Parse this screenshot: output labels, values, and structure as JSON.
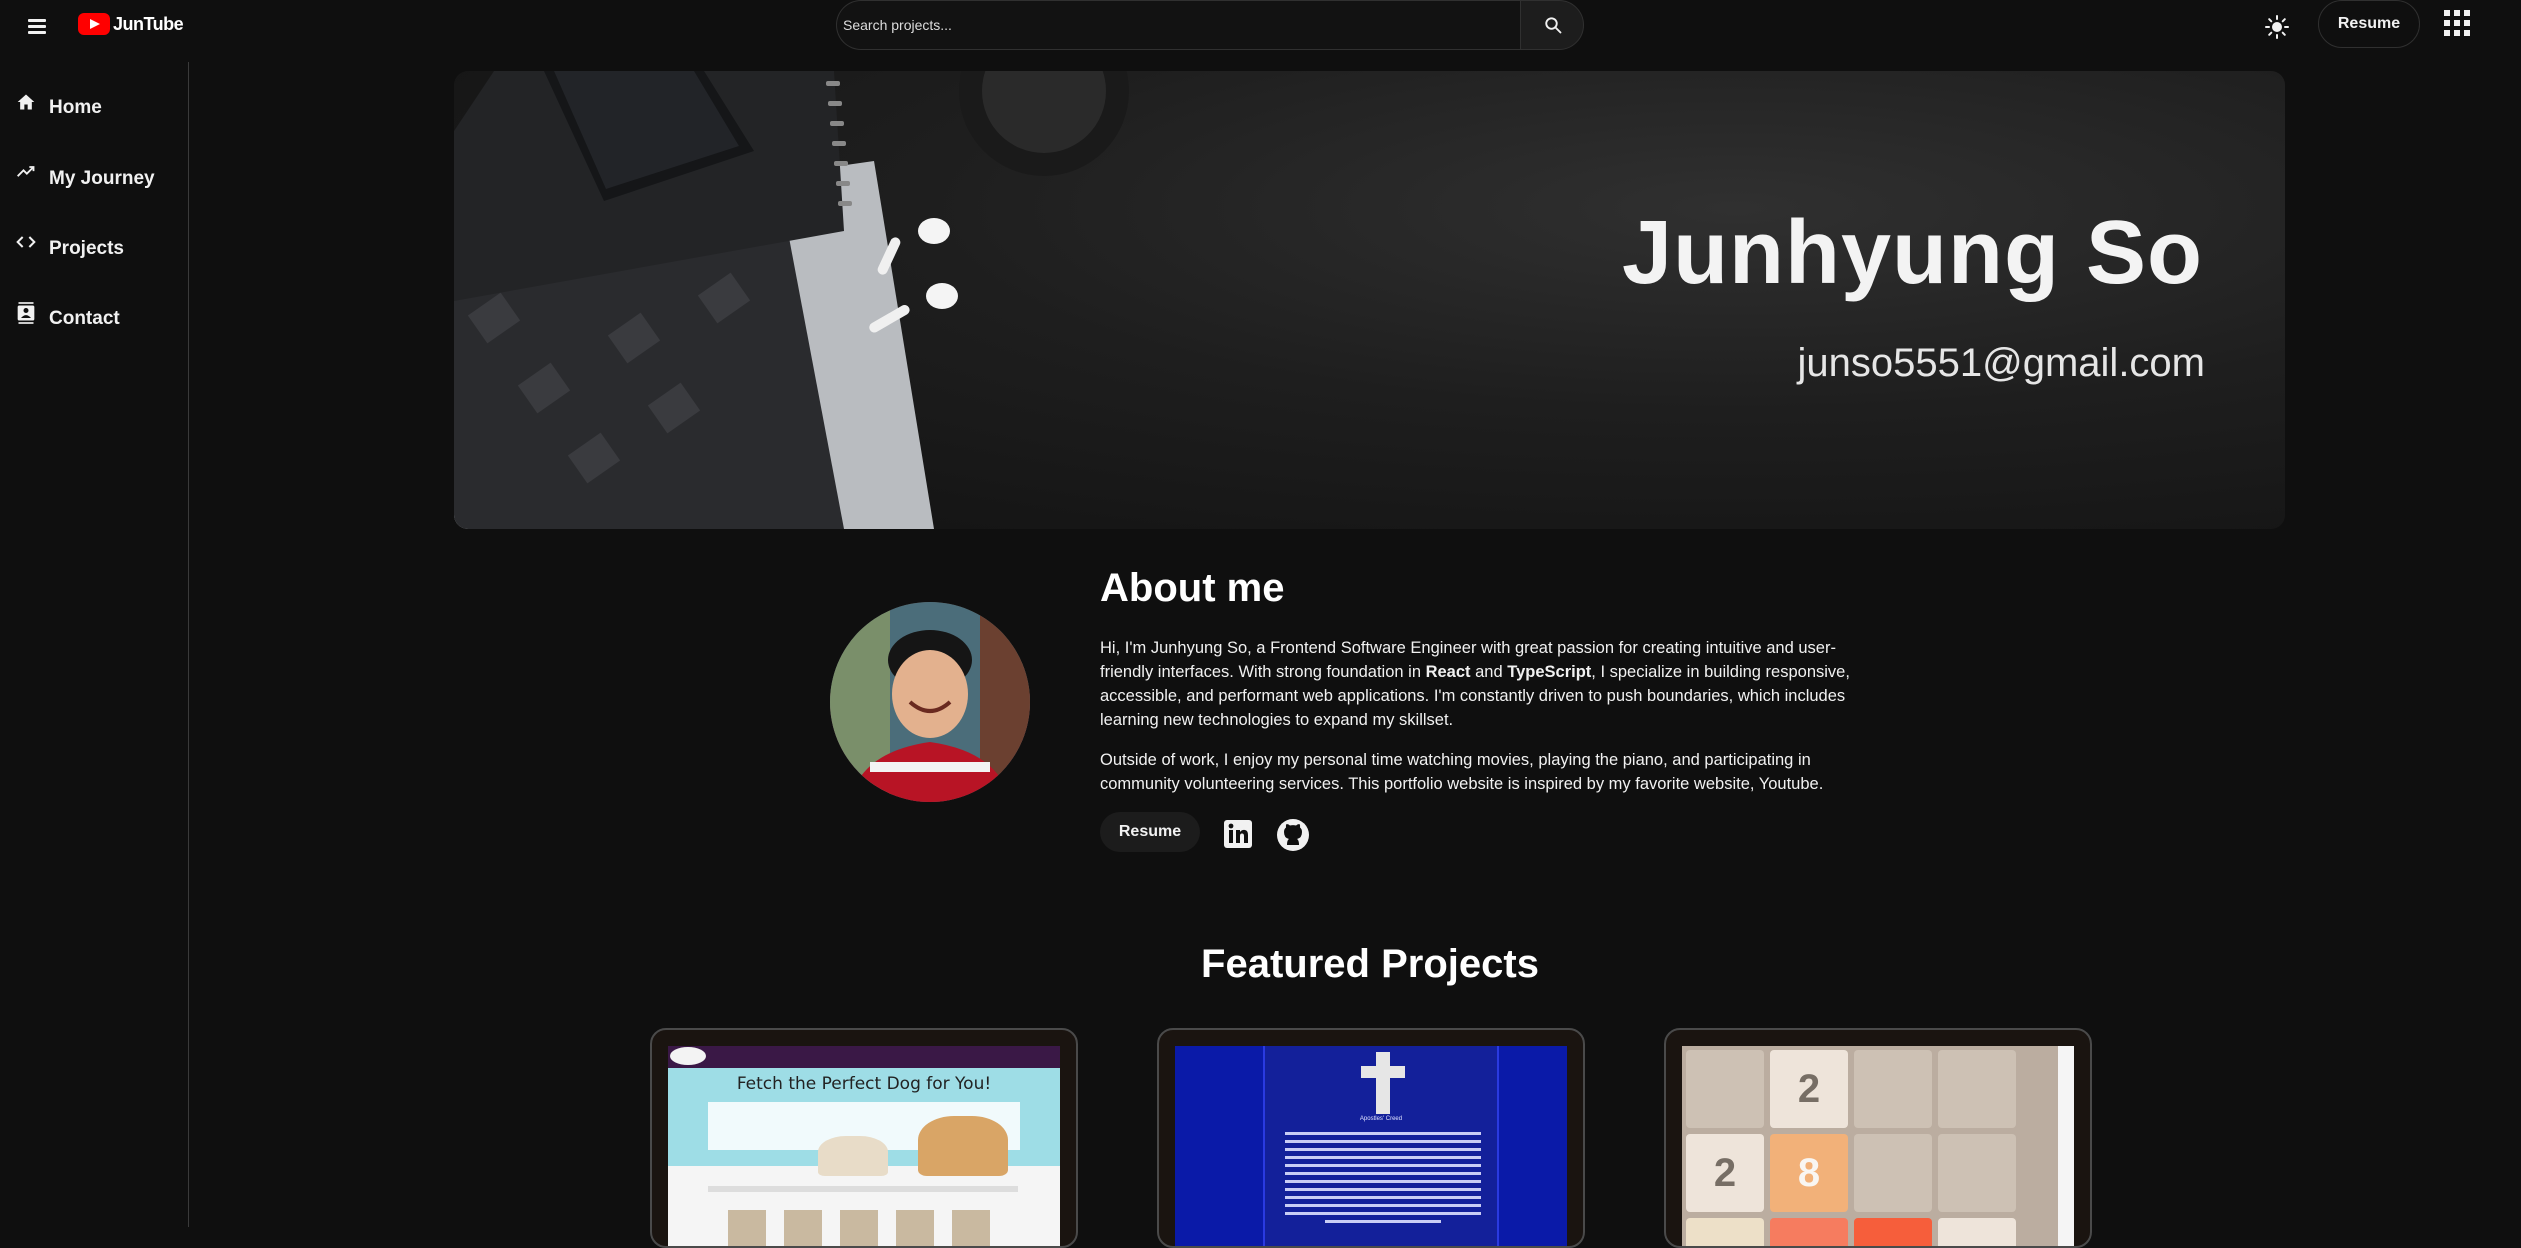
{
  "header": {
    "logo_text": "JunTube",
    "search_placeholder": "Search projects...",
    "resume_label": "Resume"
  },
  "sidebar": {
    "items": [
      {
        "label": "Home",
        "icon": "home-icon"
      },
      {
        "label": "My Journey",
        "icon": "trending-icon"
      },
      {
        "label": "Projects",
        "icon": "code-icon"
      },
      {
        "label": "Contact",
        "icon": "contact-card-icon"
      }
    ]
  },
  "banner": {
    "name": "Junhyung So",
    "email": "junso5551@gmail.com"
  },
  "about": {
    "title": "About me",
    "p1_a": "Hi, I'm Junhyung So, a Frontend Software Engineer with great passion for creating intuitive and user-friendly interfaces. With strong foundation in ",
    "p1_react": "React",
    "p1_and": " and ",
    "p1_ts": "TypeScript",
    "p1_b": ", I specialize in building responsive, accessible, and performant web applications. I'm constantly driven to push boundaries, which includes learning new technologies to expand my skillset.",
    "p2": "Outside of work, I enjoy my personal time watching movies, playing the piano, and participating in community volunteering services. This portfolio website is inspired by my favorite website, Youtube.",
    "resume_label": "Resume",
    "social_icons": [
      "linkedin-icon",
      "github-icon"
    ]
  },
  "featured": {
    "title": "Featured Projects",
    "cards": [
      {
        "thumb_title": "Fetch the Perfect Dog for You!"
      },
      {
        "thumb_title": "Apostles' Creed"
      },
      {
        "tiles": [
          "2",
          "2",
          "8"
        ]
      }
    ]
  },
  "colors": {
    "background": "#0f0f0f",
    "brand_red": "#ff0000",
    "text": "#f1f1f1"
  }
}
